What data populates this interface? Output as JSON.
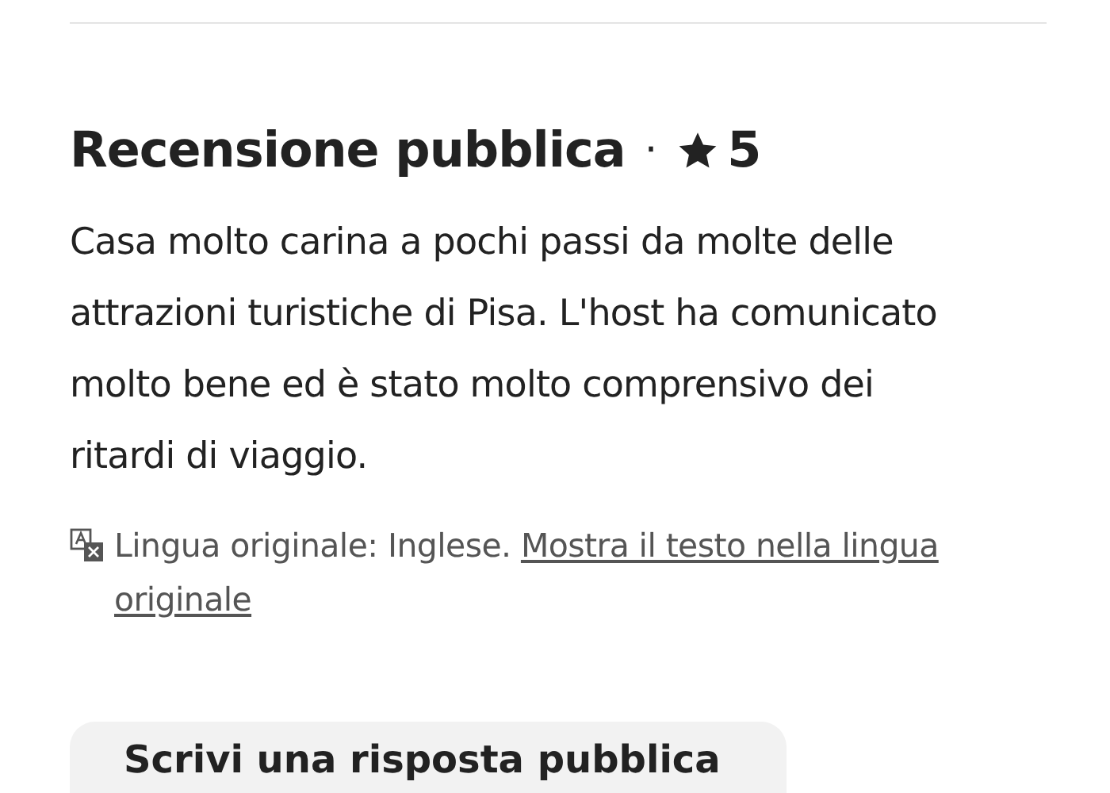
{
  "review": {
    "title": "Recensione pubblica",
    "separator": "·",
    "rating": "5",
    "body": "Casa molto carina a pochi passi da molte delle attrazioni turistiche di Pisa. L'host ha comunicato molto bene ed è stato molto comprensivo dei ritardi di viaggio.",
    "language_note": "Lingua originale: Inglese.",
    "language_link": "Mostra il testo nella lingua originale"
  },
  "reply_button": "Scrivi una risposta pubblica"
}
